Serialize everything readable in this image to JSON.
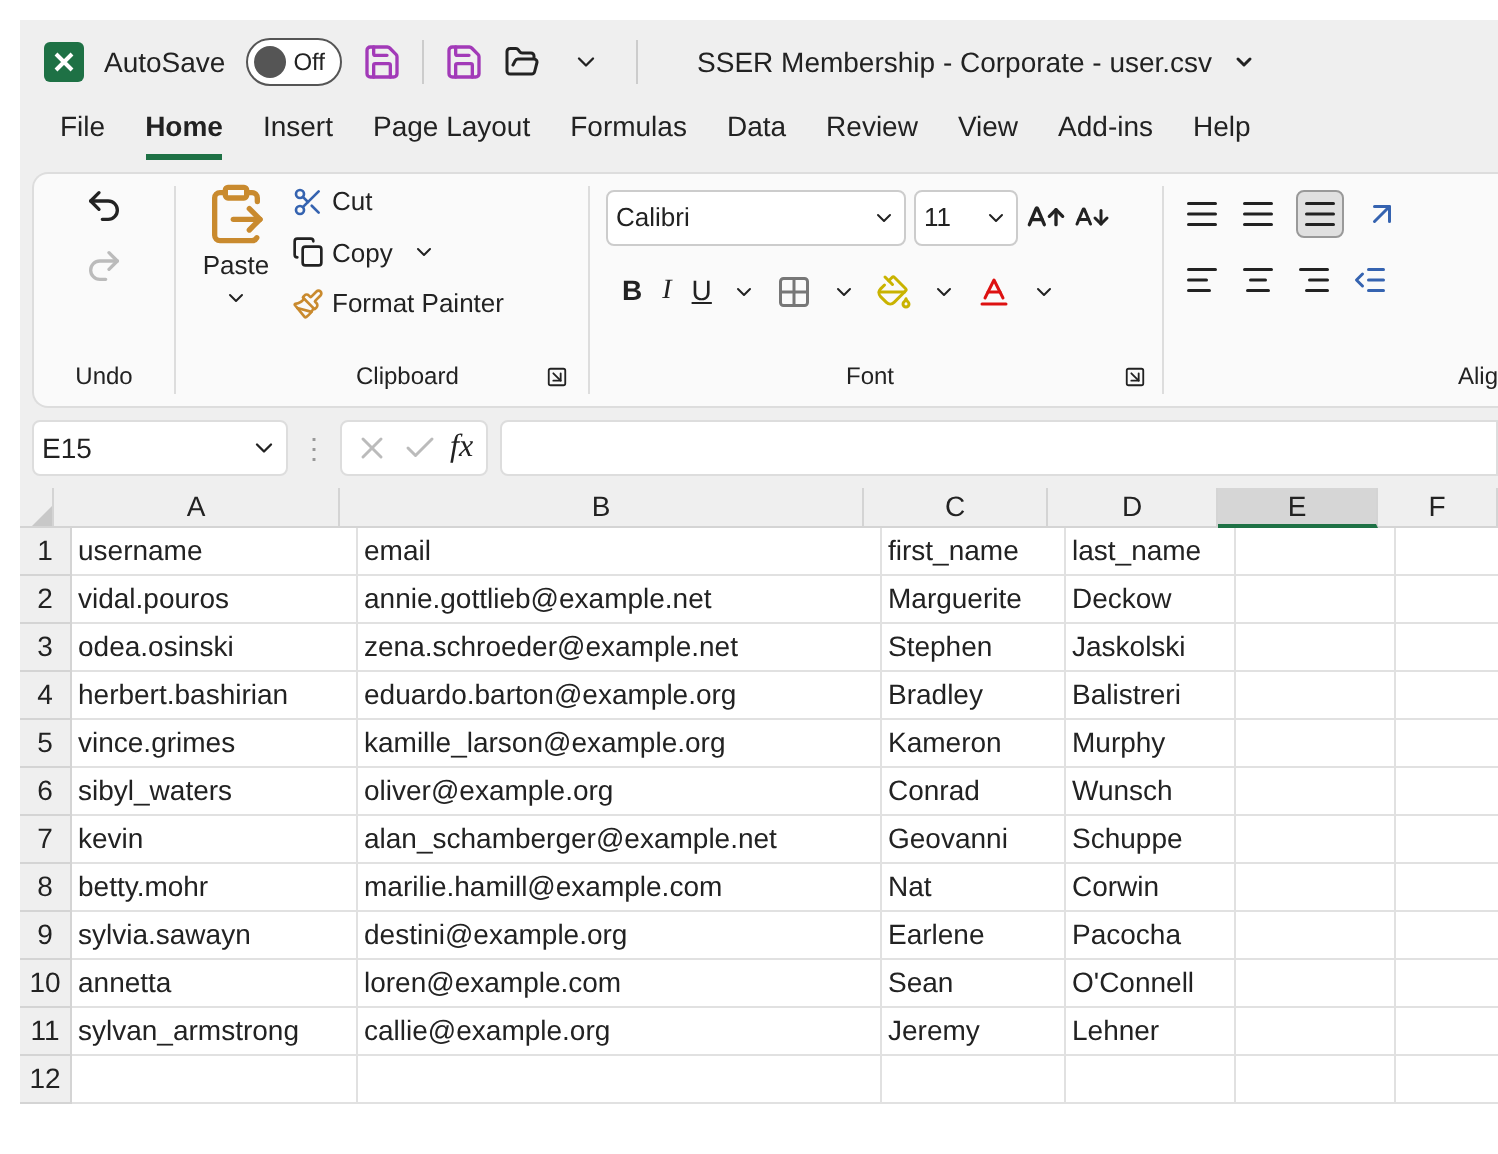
{
  "title_bar": {
    "autosave_label": "AutoSave",
    "autosave_toggle": {
      "label": "Off",
      "on": false
    },
    "title": "SSER Membership - Corporate - user.csv"
  },
  "tabs": [
    {
      "label": "File",
      "selected": false
    },
    {
      "label": "Home",
      "selected": true
    },
    {
      "label": "Insert",
      "selected": false
    },
    {
      "label": "Page Layout",
      "selected": false
    },
    {
      "label": "Formulas",
      "selected": false
    },
    {
      "label": "Data",
      "selected": false
    },
    {
      "label": "Review",
      "selected": false
    },
    {
      "label": "View",
      "selected": false
    },
    {
      "label": "Add-ins",
      "selected": false
    },
    {
      "label": "Help",
      "selected": false
    }
  ],
  "ribbon": {
    "undo_group": {
      "label": "Undo",
      "redo_disabled": true
    },
    "clipboard_group": {
      "label": "Clipboard",
      "paste": "Paste",
      "cut": "Cut",
      "copy": "Copy",
      "format_painter": "Format Painter"
    },
    "font_group": {
      "label": "Font",
      "font_name": "Calibri",
      "font_size": "11",
      "style_buttons": [
        "B",
        "I",
        "U"
      ]
    },
    "alignment_group": {
      "label": "Alig"
    }
  },
  "formula_bar": {
    "name_box": "E15",
    "handle": "⋮",
    "fx": "fx"
  },
  "grid": {
    "columns": [
      {
        "label": "A",
        "selected": false
      },
      {
        "label": "B",
        "selected": false
      },
      {
        "label": "C",
        "selected": false
      },
      {
        "label": "D",
        "selected": false
      },
      {
        "label": "E",
        "selected": true
      },
      {
        "label": "F",
        "selected": false
      }
    ],
    "rows": [
      {
        "number": "1",
        "cells": [
          "username",
          "email",
          "first_name",
          "last_name"
        ]
      },
      {
        "number": "2",
        "cells": [
          "vidal.pouros",
          "annie.gottlieb@example.net",
          "Marguerite",
          "Deckow"
        ]
      },
      {
        "number": "3",
        "cells": [
          "odea.osinski",
          "zena.schroeder@example.net",
          "Stephen",
          "Jaskolski"
        ]
      },
      {
        "number": "4",
        "cells": [
          "herbert.bashirian",
          "eduardo.barton@example.org",
          "Bradley",
          "Balistreri"
        ]
      },
      {
        "number": "5",
        "cells": [
          "vince.grimes",
          "kamille_larson@example.org",
          "Kameron",
          "Murphy"
        ]
      },
      {
        "number": "6",
        "cells": [
          "sibyl_waters",
          "oliver@example.org",
          "Conrad",
          "Wunsch"
        ]
      },
      {
        "number": "7",
        "cells": [
          "kevin",
          "alan_schamberger@example.net",
          "Geovanni",
          "Schuppe"
        ]
      },
      {
        "number": "8",
        "cells": [
          "betty.mohr",
          "marilie.hamill@example.com",
          "Nat",
          "Corwin"
        ]
      },
      {
        "number": "9",
        "cells": [
          "sylvia.sawayn",
          "destini@example.org",
          "Earlene",
          "Pacocha"
        ]
      },
      {
        "number": "10",
        "cells": [
          "annetta",
          "loren@example.com",
          "Sean",
          "O'Connell"
        ]
      },
      {
        "number": "11",
        "cells": [
          "sylvan_armstrong",
          "callie@example.org",
          "Jeremy",
          "Lehner"
        ]
      },
      {
        "number": "12",
        "cells": []
      }
    ]
  }
}
